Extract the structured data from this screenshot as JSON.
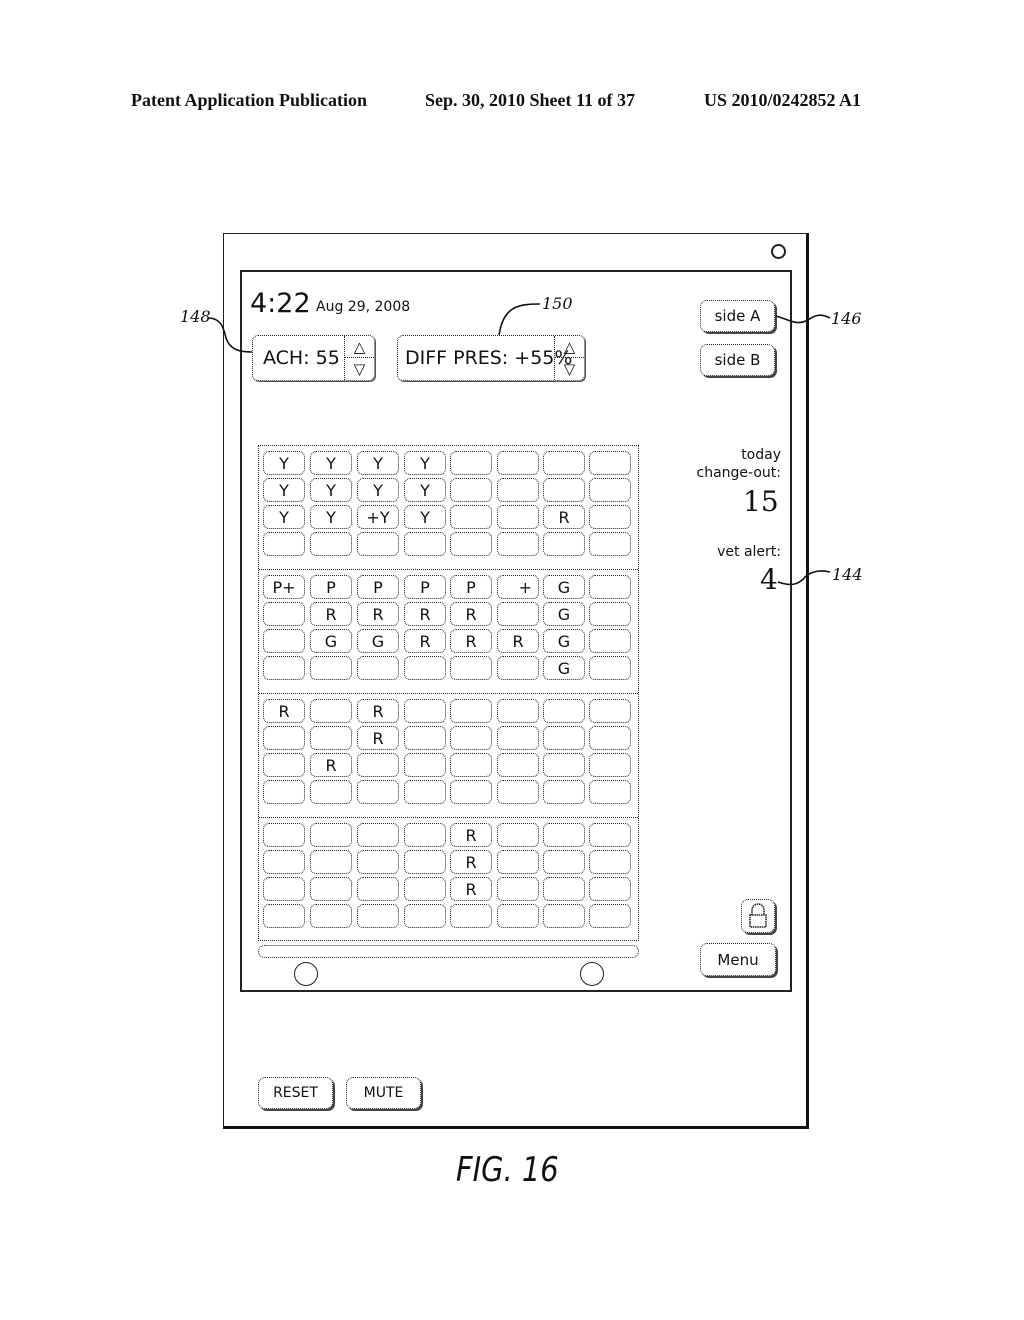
{
  "header": {
    "publication": "Patent Application Publication",
    "date_sheet": "Sep. 30, 2010   Sheet 11 of 37",
    "patent_number": "US 2010/0242852 A1"
  },
  "screen": {
    "time": "4:22",
    "date": "Aug 29, 2008",
    "ach": {
      "label": "ACH: 55",
      "up_icon": "△",
      "down_icon": "▽"
    },
    "diff_pres": {
      "label": "DIFF PRES: +55%",
      "up_icon": "△",
      "down_icon": "▽"
    },
    "side_buttons": [
      {
        "label": "side A"
      },
      {
        "label": "side B"
      }
    ],
    "change_out": {
      "label_line1": "today",
      "label_line2": "change-out:",
      "value": "15"
    },
    "vet_alert": {
      "label": "vet alert:",
      "value": "4"
    },
    "lock_icon": "lock",
    "menu_label": "Menu"
  },
  "rack": {
    "shelves": [
      [
        [
          "Y",
          "Y",
          "Y",
          "Y",
          "",
          "",
          "",
          ""
        ],
        [
          "Y",
          "Y",
          "Y",
          "Y",
          "",
          "",
          "",
          ""
        ],
        [
          "Y",
          "Y",
          "+Y",
          "Y",
          "",
          "",
          "R",
          ""
        ],
        [
          "",
          "",
          "",
          "",
          "",
          "",
          "",
          ""
        ]
      ],
      [
        [
          "P+",
          "P",
          "P",
          "P",
          "P",
          "+",
          "G",
          ""
        ],
        [
          "",
          "R",
          "R",
          "R",
          "R",
          "",
          "G",
          ""
        ],
        [
          "",
          "G",
          "G",
          "R",
          "R",
          "R",
          "G",
          ""
        ],
        [
          "",
          "",
          "",
          "",
          "",
          "",
          "G",
          ""
        ]
      ],
      [
        [
          "R",
          "",
          "R",
          "",
          "",
          "",
          "",
          ""
        ],
        [
          "",
          "",
          "R",
          "",
          "",
          "",
          "",
          ""
        ],
        [
          "",
          "R",
          "",
          "",
          "",
          "",
          "",
          ""
        ],
        [
          "",
          "",
          "",
          "",
          "",
          "",
          "",
          ""
        ]
      ],
      [
        [
          "",
          "",
          "",
          "",
          "R",
          "",
          "",
          ""
        ],
        [
          "",
          "",
          "",
          "",
          "R",
          "",
          "",
          ""
        ],
        [
          "",
          "",
          "",
          "",
          "R",
          "",
          "",
          ""
        ],
        [
          "",
          "",
          "",
          "",
          "",
          "",
          "",
          ""
        ]
      ]
    ]
  },
  "device_buttons": {
    "reset": "RESET",
    "mute": "MUTE"
  },
  "reference_numerals": {
    "ach_control": "148",
    "diff_pres_control": "150",
    "side_buttons": "146",
    "vet_alert": "144"
  },
  "figure_caption": "FIG. 16"
}
